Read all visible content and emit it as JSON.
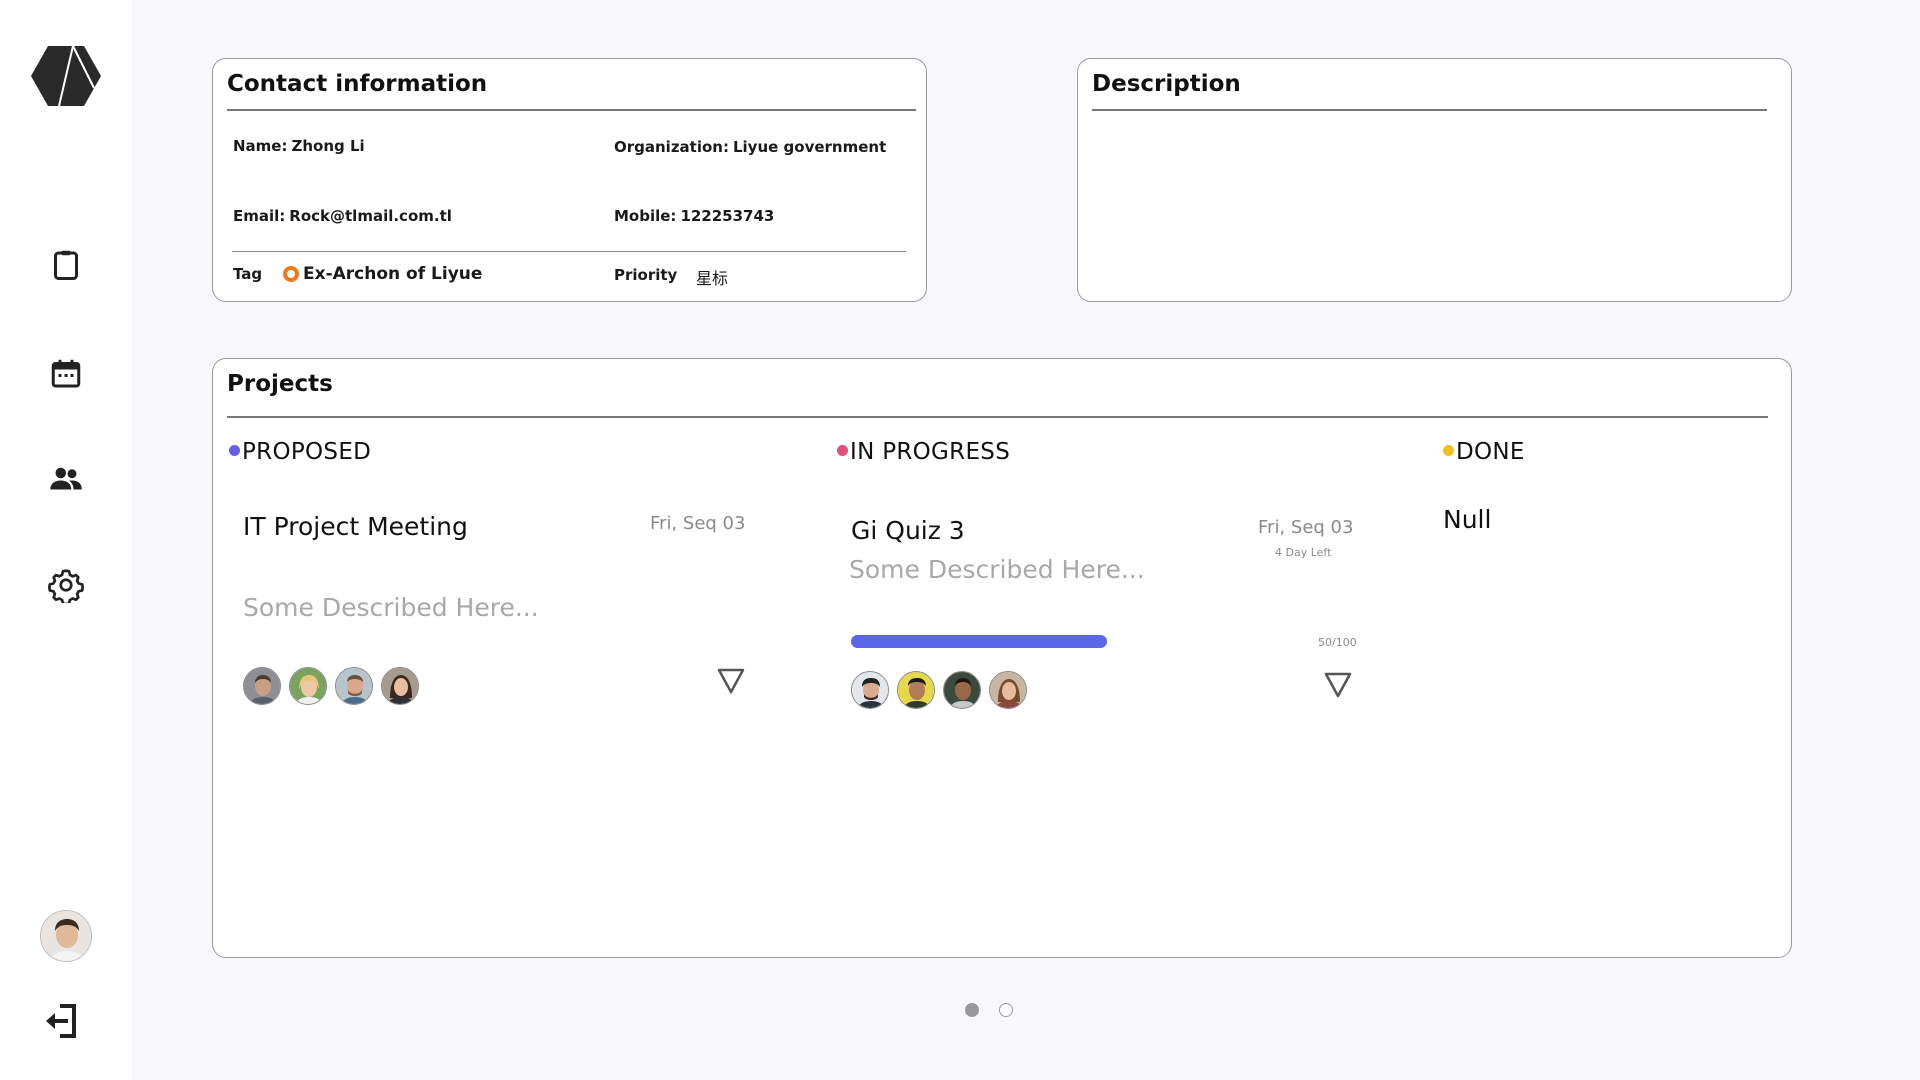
{
  "sidebar": {
    "logo_icon": "hexagon-logo-icon",
    "nav": [
      {
        "icon": "clipboard-icon"
      },
      {
        "icon": "calendar-icon"
      },
      {
        "icon": "people-icon"
      },
      {
        "icon": "gear-icon"
      }
    ],
    "logout_icon": "logout-icon"
  },
  "contact": {
    "title": "Contact information",
    "name_label": "Name:",
    "name": "Zhong Li",
    "org_label": "Organization:",
    "org": "Liyue government",
    "email_label": "Email:",
    "email": "Rock@tlmail.com.tl",
    "mobile_label": "Mobile:",
    "mobile": "122253743",
    "tag_label": "Tag",
    "tag": "Ex-Archon of Liyue",
    "tag_color": "#f07a1a",
    "priority_label": "Priority",
    "priority": "星标"
  },
  "description": {
    "title": "Description"
  },
  "projects": {
    "title": "Projects",
    "columns": [
      {
        "status": "PROPOSED",
        "color": "#6a5fe0",
        "item": {
          "title": "IT Project Meeting",
          "date": "Fri, Seq 03",
          "description": "Some Described Here..."
        }
      },
      {
        "status": "IN PROGRESS",
        "color": "#e0507a",
        "item": {
          "title": "Gi Quiz 3",
          "date": "Fri, Seq 03",
          "days_left": "4 Day Left",
          "description": "Some Described Here...",
          "progress_text": "50/100",
          "progress": 0.5,
          "progress_color": "#5c66e8"
        }
      },
      {
        "status": "DONE",
        "color": "#f0c020",
        "empty_text": "Null"
      }
    ]
  },
  "pager": {
    "pages": 2,
    "active": 1
  }
}
